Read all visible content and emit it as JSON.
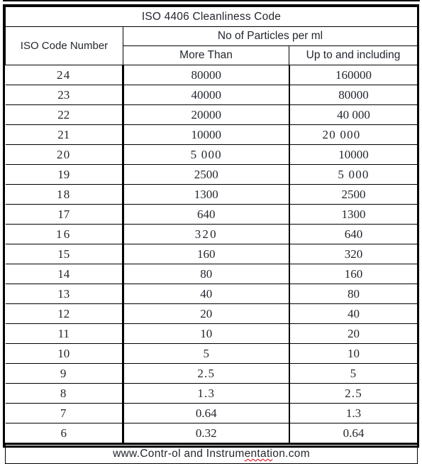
{
  "title": "ISO 4406 Cleanliness Code",
  "header": {
    "code_column": "ISO Code Number",
    "particles_group": "No of Particles per ml",
    "more_than": "More Than",
    "up_to_and_including": "Up to and including"
  },
  "footer": {
    "url_prefix": "www.Contr-ol and Instrum",
    "url_misspelled": "entati",
    "url_suffix": "on.com",
    "spellcheck_underline_color": "#e8000d"
  },
  "colors": {
    "border": "#000000",
    "text": "#23272e",
    "faint_text": "#5d6066"
  },
  "table_data": {
    "type": "table",
    "columns": [
      "ISO Code Number",
      "More Than",
      "Up to and including"
    ],
    "rows": [
      {
        "code": "24",
        "code_style": "faint",
        "more": "80000",
        "more_style": "normal",
        "upto": "160000",
        "upto_style": "normal"
      },
      {
        "code": "23",
        "code_style": "normal",
        "more": "40000",
        "more_style": "normal",
        "upto": "80000",
        "upto_style": "normal"
      },
      {
        "code": "22",
        "code_style": "normal",
        "more": "20000",
        "more_style": "normal",
        "upto": "40 000",
        "upto_style": "normal"
      },
      {
        "code": "21",
        "code_style": "normal",
        "more": "10000",
        "more_style": "normal",
        "upto": "20 000",
        "upto_style": "faint-shift"
      },
      {
        "code": "20",
        "code_style": "faint",
        "more": "5 000",
        "more_style": "faint",
        "upto": "10000",
        "upto_style": "normal"
      },
      {
        "code": "19",
        "code_style": "normal",
        "more": "2500",
        "more_style": "normal",
        "upto": "5 000",
        "upto_style": "faint"
      },
      {
        "code": "18",
        "code_style": "faint",
        "more": "1300",
        "more_style": "normal",
        "upto": "2500",
        "upto_style": "normal"
      },
      {
        "code": "17",
        "code_style": "normal",
        "more": "640",
        "more_style": "normal",
        "upto": "1300",
        "upto_style": "normal"
      },
      {
        "code": "16",
        "code_style": "faint-wide",
        "more": "320",
        "more_style": "faint-wide",
        "upto": "640",
        "upto_style": "normal"
      },
      {
        "code": "15",
        "code_style": "normal",
        "more": "160",
        "more_style": "normal",
        "upto": "320",
        "upto_style": "normal"
      },
      {
        "code": "14",
        "code_style": "normal",
        "more": "80",
        "more_style": "normal",
        "upto": "160",
        "upto_style": "normal"
      },
      {
        "code": "13",
        "code_style": "normal",
        "more": "40",
        "more_style": "normal",
        "upto": "80",
        "upto_style": "normal"
      },
      {
        "code": "12",
        "code_style": "normal",
        "more": "20",
        "more_style": "normal",
        "upto": "40",
        "upto_style": "normal"
      },
      {
        "code": "11",
        "code_style": "normal",
        "more": "10",
        "more_style": "normal",
        "upto": "20",
        "upto_style": "normal"
      },
      {
        "code": "10",
        "code_style": "normal",
        "more": "5",
        "more_style": "normal",
        "upto": "10",
        "upto_style": "normal"
      },
      {
        "code": "9",
        "code_style": "faint",
        "more": "2.5",
        "more_style": "faint",
        "upto": "5",
        "upto_style": "faint"
      },
      {
        "code": "8",
        "code_style": "faint",
        "more": "1.3",
        "more_style": "faint",
        "upto": "2.5",
        "upto_style": "faint"
      },
      {
        "code": "7",
        "code_style": "faint",
        "more": "0.64",
        "more_style": "normal",
        "upto": "1.3",
        "upto_style": "normal"
      },
      {
        "code": "6",
        "code_style": "normal",
        "more": "0.32",
        "more_style": "normal",
        "upto": "0.64",
        "upto_style": "normal"
      }
    ]
  }
}
